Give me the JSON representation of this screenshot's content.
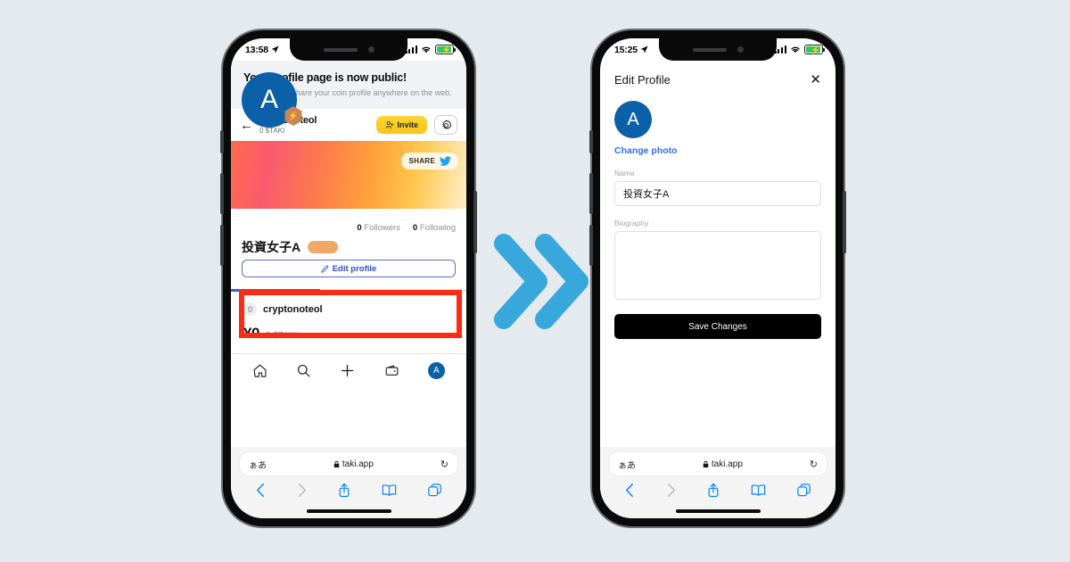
{
  "page": {
    "background_color": "#e4eaee",
    "arrow_icon": "double-chevron-right",
    "arrow_color": "#38a8dc",
    "highlight_color": "#fc2b14"
  },
  "left_phone": {
    "status_bar": {
      "time": "13:58",
      "location_icon": "➤",
      "signal": "signal-bars",
      "wifi": "wifi-icon",
      "battery": "battery-charging",
      "battery_color": "#34c759"
    },
    "promo_banner": {
      "title": "Your Profile page is now public!",
      "subtitle": "Now you can share your coin profile anywhere on the web."
    },
    "profile_bar": {
      "back_icon": "←",
      "handle": "cryptonoteol",
      "balance": "0 $TAKI",
      "invite_label": "Invite",
      "invite_icon": "person-add-icon",
      "invite_color": "#f5c518",
      "settings_icon": "gear-icon"
    },
    "cover": {
      "share_label": "SHARE",
      "share_icon": "twitter-bird-icon",
      "avatar_initial": "A",
      "avatar_color": "#0b60a8",
      "badge_icon": "⚡",
      "badge_color": "#c98554"
    },
    "stats": {
      "followers_count": "0",
      "followers_label": "Followers",
      "following_count": "0",
      "following_label": "Following"
    },
    "display_name": "投資女子A",
    "edit_profile": {
      "label": "Edit profile",
      "icon": "pencil-icon"
    },
    "holdings": {
      "coin_icon": "0",
      "coin_name": "cryptonoteol",
      "amount": "¥0",
      "amount_sub": "0 $TAKI"
    },
    "tab_bar": {
      "items": [
        {
          "name": "home-icon",
          "glyph": "home"
        },
        {
          "name": "search-icon",
          "glyph": "search"
        },
        {
          "name": "add-icon",
          "glyph": "plus"
        },
        {
          "name": "wallet-icon",
          "glyph": "wallet"
        },
        {
          "name": "profile-avatar",
          "glyph": "A"
        }
      ]
    },
    "safari": {
      "aa_label": "ぁあ",
      "lock_icon": "🔒",
      "url": "taki.app",
      "reload_icon": "↻",
      "back_icon": "‹",
      "forward_icon": "›",
      "share_icon": "share-up-icon",
      "bookmarks_icon": "book-icon",
      "tabs_icon": "tabs-icon"
    }
  },
  "right_phone": {
    "status_bar": {
      "time": "15:25",
      "location_icon": "➤",
      "signal": "signal-bars",
      "wifi": "wifi-icon",
      "battery": "battery-charging",
      "battery_color": "#34c759"
    },
    "header": {
      "title": "Edit Profile",
      "close_icon": "✕"
    },
    "avatar": {
      "initial": "A",
      "color": "#0b60a8"
    },
    "change_photo_label": "Change photo",
    "name_field": {
      "label": "Name",
      "value": "投資女子A"
    },
    "biography_field": {
      "label": "Biography",
      "value": ""
    },
    "save_button": {
      "label": "Save Changes",
      "color": "#000000"
    },
    "safari": {
      "aa_label": "ぁあ",
      "lock_icon": "🔒",
      "url": "taki.app",
      "reload_icon": "↻",
      "back_icon": "‹",
      "forward_icon": "›",
      "share_icon": "share-up-icon",
      "bookmarks_icon": "book-icon",
      "tabs_icon": "tabs-icon"
    }
  }
}
